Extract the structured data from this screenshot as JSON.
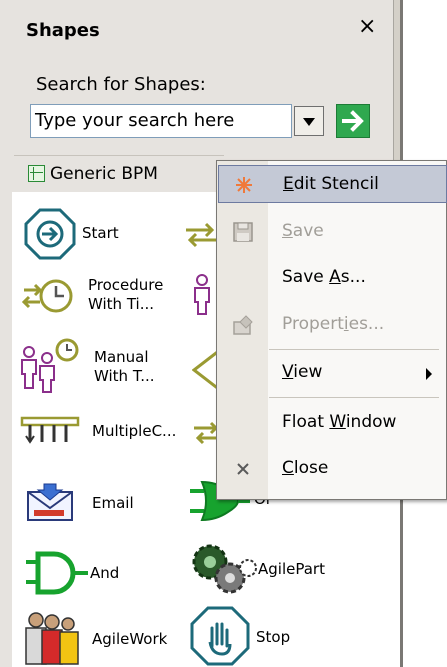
{
  "panel": {
    "title": "Shapes",
    "close_glyph": "×",
    "search_label": "Search for Shapes:",
    "search_value": "Type your search here",
    "stencil_name": "Generic BPM"
  },
  "shapes": [
    {
      "label": "Start",
      "icon": "start-arrow-icon"
    },
    {
      "label": "Procedure\nWith Ti...",
      "icon": "procedure-timer-icon"
    },
    {
      "label": "Manual\nWith T...",
      "icon": "manual-timer-icon"
    },
    {
      "label": "MultipleC...",
      "icon": "multiple-choice-icon"
    },
    {
      "label": "Email",
      "icon": "email-icon"
    },
    {
      "label": "Or",
      "icon": "or-gate-icon"
    },
    {
      "label": "And",
      "icon": "and-gate-icon"
    },
    {
      "label": "AgilePart",
      "icon": "agilepart-gears-icon"
    },
    {
      "label": "AgileWork",
      "icon": "agilework-people-icon"
    },
    {
      "label": "Stop",
      "icon": "stop-hand-icon"
    }
  ],
  "menu": {
    "items": [
      {
        "label": "Edit Stencil",
        "accel": "E",
        "disabled": false,
        "icon": "edit-star-icon"
      },
      {
        "label": "Save",
        "accel": "S",
        "disabled": true,
        "icon": "save-disk-icon"
      },
      {
        "label": "Save As...",
        "accel": "A",
        "disabled": false,
        "icon": ""
      },
      {
        "label": "Properties...",
        "accel": "i",
        "disabled": true,
        "icon": "properties-icon"
      },
      {
        "label": "View",
        "accel": "V",
        "disabled": false,
        "icon": "",
        "submenu": true
      },
      {
        "label": "Float Window",
        "accel": "W",
        "disabled": false,
        "icon": ""
      },
      {
        "label": "Close",
        "accel": "C",
        "disabled": false,
        "icon": "close-x-icon"
      }
    ]
  },
  "colors": {
    "accent_teal": "#1d6a7a",
    "go_green": "#2fa84f",
    "gate_green": "#17a32e",
    "menu_highlight": "#c4c9d6"
  }
}
